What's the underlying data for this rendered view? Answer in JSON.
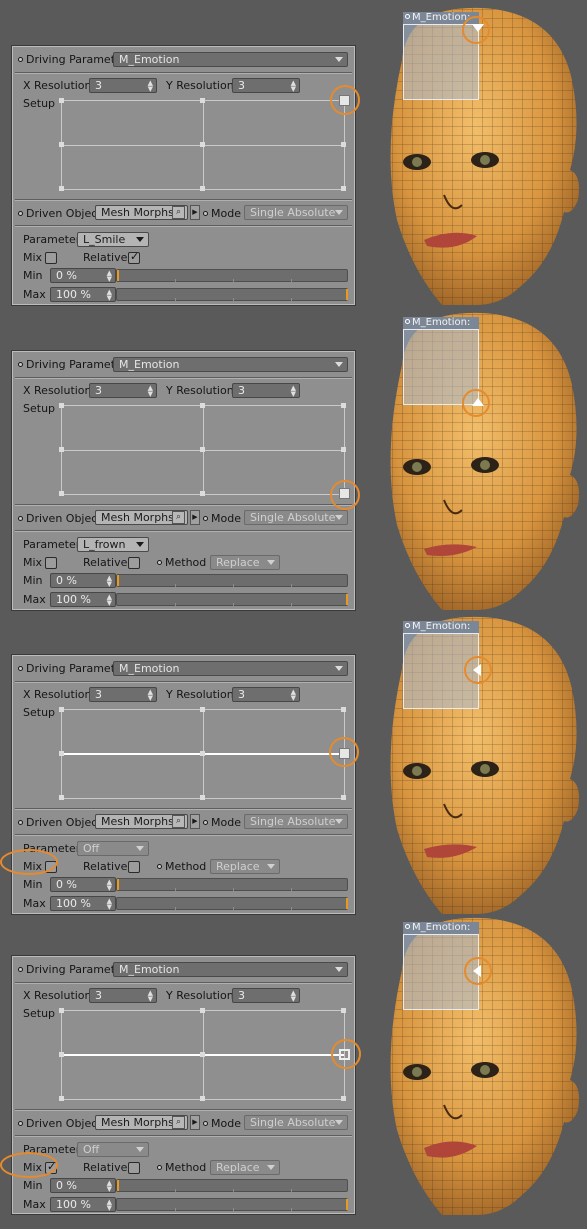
{
  "labels": {
    "driving_parameter": "Driving Parameter",
    "x_resolution": "X Resolution",
    "y_resolution": "Y Resolution",
    "setup": "Setup",
    "driven_object": "Driven Object",
    "mode": "Mode",
    "parameter": "Parameter",
    "mix": "Mix",
    "relative": "Relative",
    "method": "Method",
    "min": "Min",
    "max": "Max"
  },
  "panels": [
    {
      "driving_parameter": "M_Emotion",
      "x_resolution": "3",
      "y_resolution": "3",
      "driven_object": "Mesh Morphs",
      "mode": "Single Absolute",
      "parameter": "L_Smile",
      "mix_checked": false,
      "relative_checked": true,
      "show_method": false,
      "method": "",
      "min": "0 %",
      "max": "100 %",
      "selected_point": "top-right",
      "overlay_label": "M_Emotion:"
    },
    {
      "driving_parameter": "M_Emotion",
      "x_resolution": "3",
      "y_resolution": "3",
      "driven_object": "Mesh Morphs",
      "mode": "Single Absolute",
      "parameter": "L_frown",
      "mix_checked": false,
      "relative_checked": false,
      "show_method": true,
      "method": "Replace",
      "min": "0 %",
      "max": "100 %",
      "selected_point": "bottom-right",
      "overlay_label": "M_Emotion:"
    },
    {
      "driving_parameter": "M_Emotion",
      "x_resolution": "3",
      "y_resolution": "3",
      "driven_object": "Mesh Morphs",
      "mode": "Single Absolute",
      "parameter": "Off",
      "mix_checked": false,
      "relative_checked": false,
      "show_method": true,
      "method": "Replace",
      "min": "0 %",
      "max": "100 %",
      "selected_point": "middle-right",
      "overlay_label": "M_Emotion:"
    },
    {
      "driving_parameter": "M_Emotion",
      "x_resolution": "3",
      "y_resolution": "3",
      "driven_object": "Mesh Morphs",
      "mode": "Single Absolute",
      "parameter": "Off",
      "mix_checked": true,
      "relative_checked": false,
      "show_method": true,
      "method": "Replace",
      "min": "0 %",
      "max": "100 %",
      "selected_point": "middle-right",
      "overlay_label": "M_Emotion:"
    }
  ],
  "colors": {
    "highlight": "#e58b2e",
    "panel_bg": "#8f8f8f",
    "slider_mark": "#e89a20",
    "skin": "#e0a24a"
  }
}
